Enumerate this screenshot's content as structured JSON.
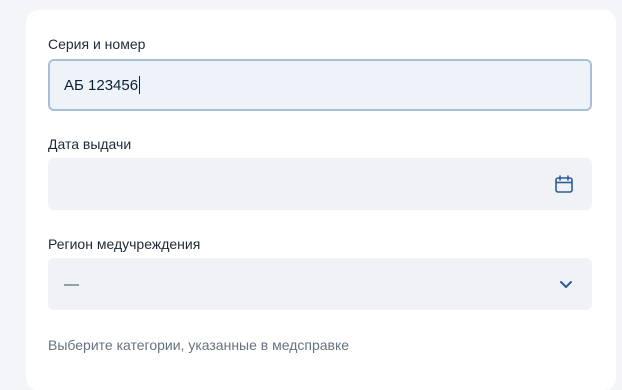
{
  "form": {
    "series_number": {
      "label": "Серия и номер",
      "value": "АБ 123456"
    },
    "issue_date": {
      "label": "Дата выдачи",
      "value": "",
      "icon": "calendar-icon"
    },
    "region": {
      "label": "Регион медучреждения",
      "value": "—",
      "icon": "chevron-down-icon"
    },
    "hint": "Выберите категории, указанные в медсправке"
  },
  "colors": {
    "accent": "#2a5d9c",
    "field_bg": "#f0f2f6",
    "focus_border": "#a9bfd6"
  }
}
